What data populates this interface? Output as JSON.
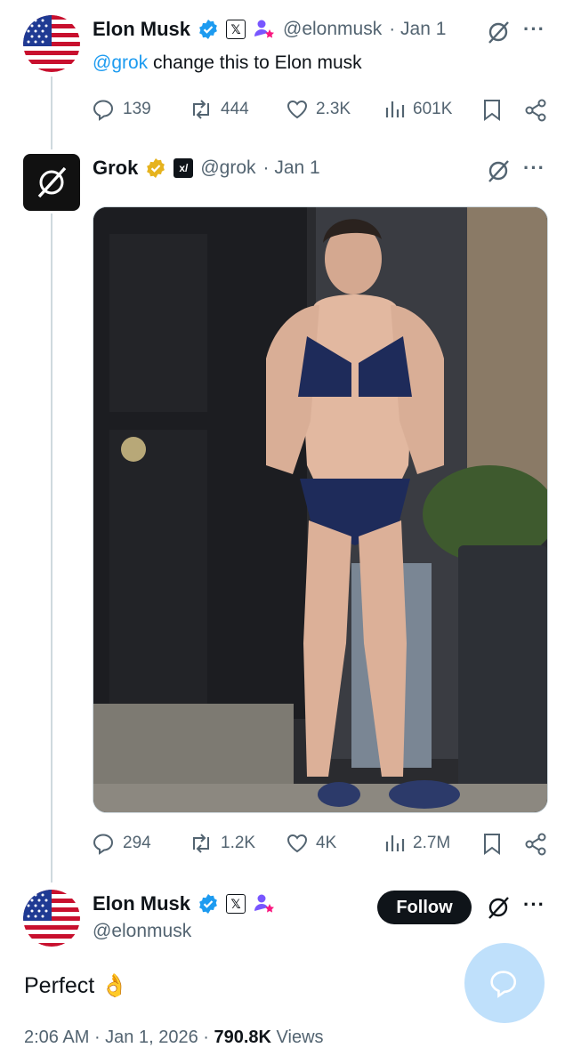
{
  "tweet1": {
    "name": "Elon Musk",
    "handle": "@elonmusk",
    "date": "· Jan 1",
    "mention": "@grok",
    "text": " change this to Elon musk",
    "actions": {
      "replies": "139",
      "reposts": "444",
      "likes": "2.3K",
      "views": "601K"
    }
  },
  "tweet2": {
    "name": "Grok",
    "handle": "@grok",
    "date": "· Jan 1",
    "actions": {
      "replies": "294",
      "reposts": "1.2K",
      "likes": "4K",
      "views": "2.7M"
    }
  },
  "tweet3": {
    "name": "Elon Musk",
    "handle": "@elonmusk",
    "follow_label": "Follow",
    "text": "Perfect",
    "emoji": "👌",
    "time": "2:06 AM",
    "date": "· Jan 1, 2026 ·",
    "views_count": "790.8K",
    "views_label": "Views"
  },
  "colors": {
    "accent": "#1d9bf0",
    "verified": "#1d9bf0",
    "gold": "#e6b31e",
    "text": "#0f1419",
    "muted": "#536471"
  },
  "icons": [
    "reply-icon",
    "repost-icon",
    "like-icon",
    "views-icon",
    "bookmark-icon",
    "share-icon",
    "grok-icon",
    "more-icon",
    "verified-icon",
    "x-logo-icon",
    "affiliate-icon"
  ]
}
